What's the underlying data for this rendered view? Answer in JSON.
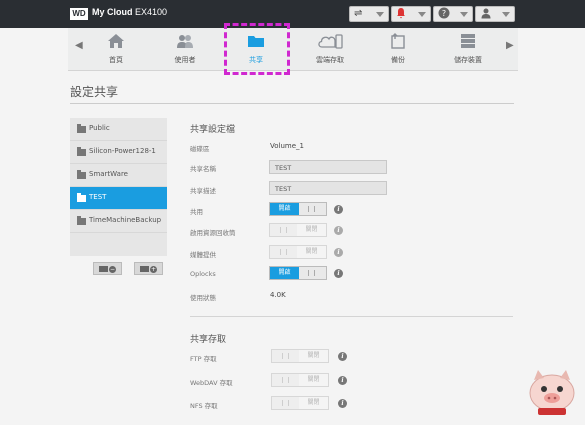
{
  "header": {
    "logo": "WD",
    "brand": "My Cloud",
    "model": "EX4100",
    "buttons": [
      {
        "icon": "usb-icon",
        "glyph": "⇌"
      },
      {
        "icon": "alert-bell-icon",
        "glyph": "🔔"
      },
      {
        "icon": "help-icon",
        "glyph": "?"
      },
      {
        "icon": "user-icon",
        "glyph": "👤"
      }
    ]
  },
  "nav": {
    "items": [
      {
        "label": "首頁",
        "icon": "home-icon"
      },
      {
        "label": "使用者",
        "icon": "users-icon"
      },
      {
        "label": "共享",
        "icon": "folder-icon"
      },
      {
        "label": "雲端存取",
        "icon": "cloud-icon"
      },
      {
        "label": "備份",
        "icon": "backup-icon"
      },
      {
        "label": "儲存裝置",
        "icon": "storage-icon"
      }
    ],
    "active": "共享"
  },
  "page": {
    "title": "設定共享"
  },
  "shares": [
    "Public",
    "Silicon-Power128-1",
    "SmartWare",
    "TEST",
    "TimeMachineBackup"
  ],
  "selected_share": "TEST",
  "profile": {
    "heading": "共享設定檔",
    "volume_label": "磁碟區",
    "volume_value": "Volume_1",
    "name_label": "共享名稱",
    "name_value": "TEST",
    "desc_label": "共享描述",
    "desc_value": "TEST",
    "public_label": "共用",
    "recycle_label": "啟用資源回收筒",
    "media_label": "媒體提供",
    "oplocks_label": "Oplocks",
    "usage_label": "使用狀態",
    "usage_value": "4.0K",
    "on_text": "開啟",
    "off_text": "關閉"
  },
  "access": {
    "heading": "共享存取",
    "ftp_label": "FTP 存取",
    "webdav_label": "WebDAV 存取",
    "nfs_label": "NFS 存取"
  },
  "colors": {
    "accent": "#1a9de0",
    "highlight": "#d028d0",
    "topbar": "#2a2e33"
  }
}
